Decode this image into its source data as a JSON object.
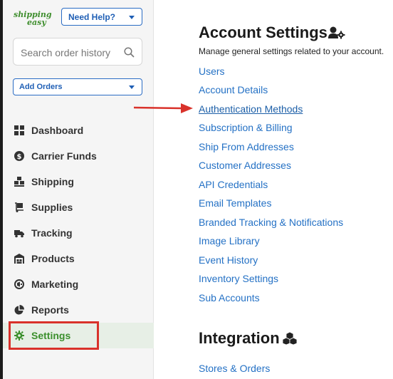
{
  "app": {
    "logo_text": "shipping easy",
    "help_button": "Need Help?",
    "search_placeholder": "Search order history",
    "add_orders": "Add Orders"
  },
  "sidebar": {
    "items": [
      {
        "label": "Dashboard",
        "icon": "dashboard-icon"
      },
      {
        "label": "Carrier Funds",
        "icon": "dollar-icon"
      },
      {
        "label": "Shipping",
        "icon": "boxes-icon"
      },
      {
        "label": "Supplies",
        "icon": "dolly-icon"
      },
      {
        "label": "Tracking",
        "icon": "truck-icon"
      },
      {
        "label": "Products",
        "icon": "warehouse-icon"
      },
      {
        "label": "Marketing",
        "icon": "megaphone-icon"
      },
      {
        "label": "Reports",
        "icon": "pie-chart-icon"
      },
      {
        "label": "Settings",
        "icon": "gear-icon",
        "active": true
      }
    ]
  },
  "main": {
    "title": "Account Settings",
    "subtitle": "Manage general settings related to your account.",
    "links": [
      "Users",
      "Account Details",
      "Authentication Methods",
      "Subscription & Billing",
      "Ship From Addresses",
      "Customer Addresses",
      "API Credentials",
      "Email Templates",
      "Branded Tracking & Notifications",
      "Image Library",
      "Event History",
      "Inventory Settings",
      "Sub Accounts"
    ],
    "integration_title": "Integration",
    "integration_links": [
      "Stores & Orders"
    ]
  },
  "colors": {
    "link": "#2471c5",
    "active_green": "#3a8f2c",
    "annotation_red": "#d9322b",
    "brand_blue": "#1f5fb5"
  }
}
